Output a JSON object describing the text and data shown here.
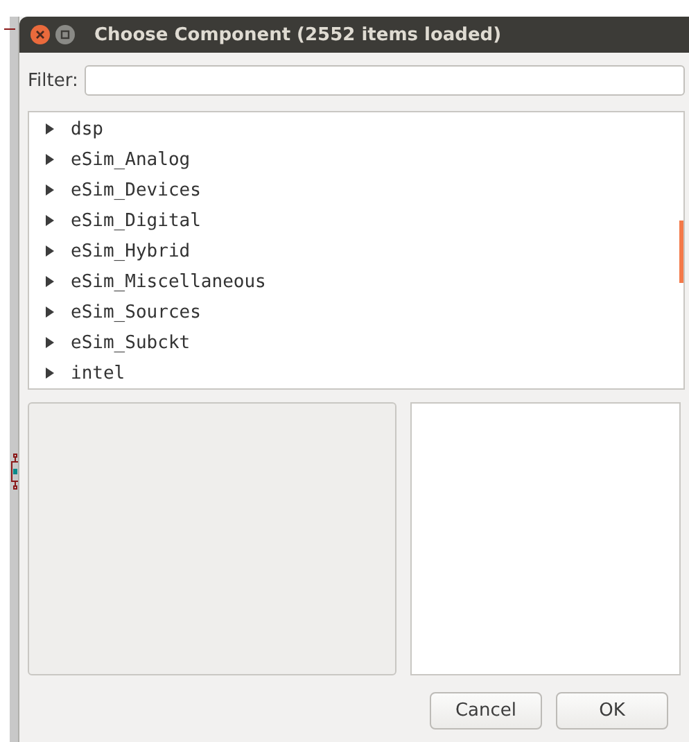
{
  "window": {
    "title": "Choose Component (2552 items loaded)"
  },
  "filter": {
    "label": "Filter:"
  },
  "libraries": [
    {
      "name": "dsp",
      "expanded": false
    },
    {
      "name": "eSim_Analog",
      "expanded": false
    },
    {
      "name": "eSim_Devices",
      "expanded": false
    },
    {
      "name": "eSim_Digital",
      "expanded": false
    },
    {
      "name": "eSim_Hybrid",
      "expanded": false
    },
    {
      "name": "eSim_Miscellaneous",
      "expanded": false
    },
    {
      "name": "eSim_Sources",
      "expanded": false
    },
    {
      "name": "eSim_Subckt",
      "expanded": false
    },
    {
      "name": "intel",
      "expanded": false
    }
  ],
  "buttons": [
    "Cancel",
    "OK"
  ]
}
